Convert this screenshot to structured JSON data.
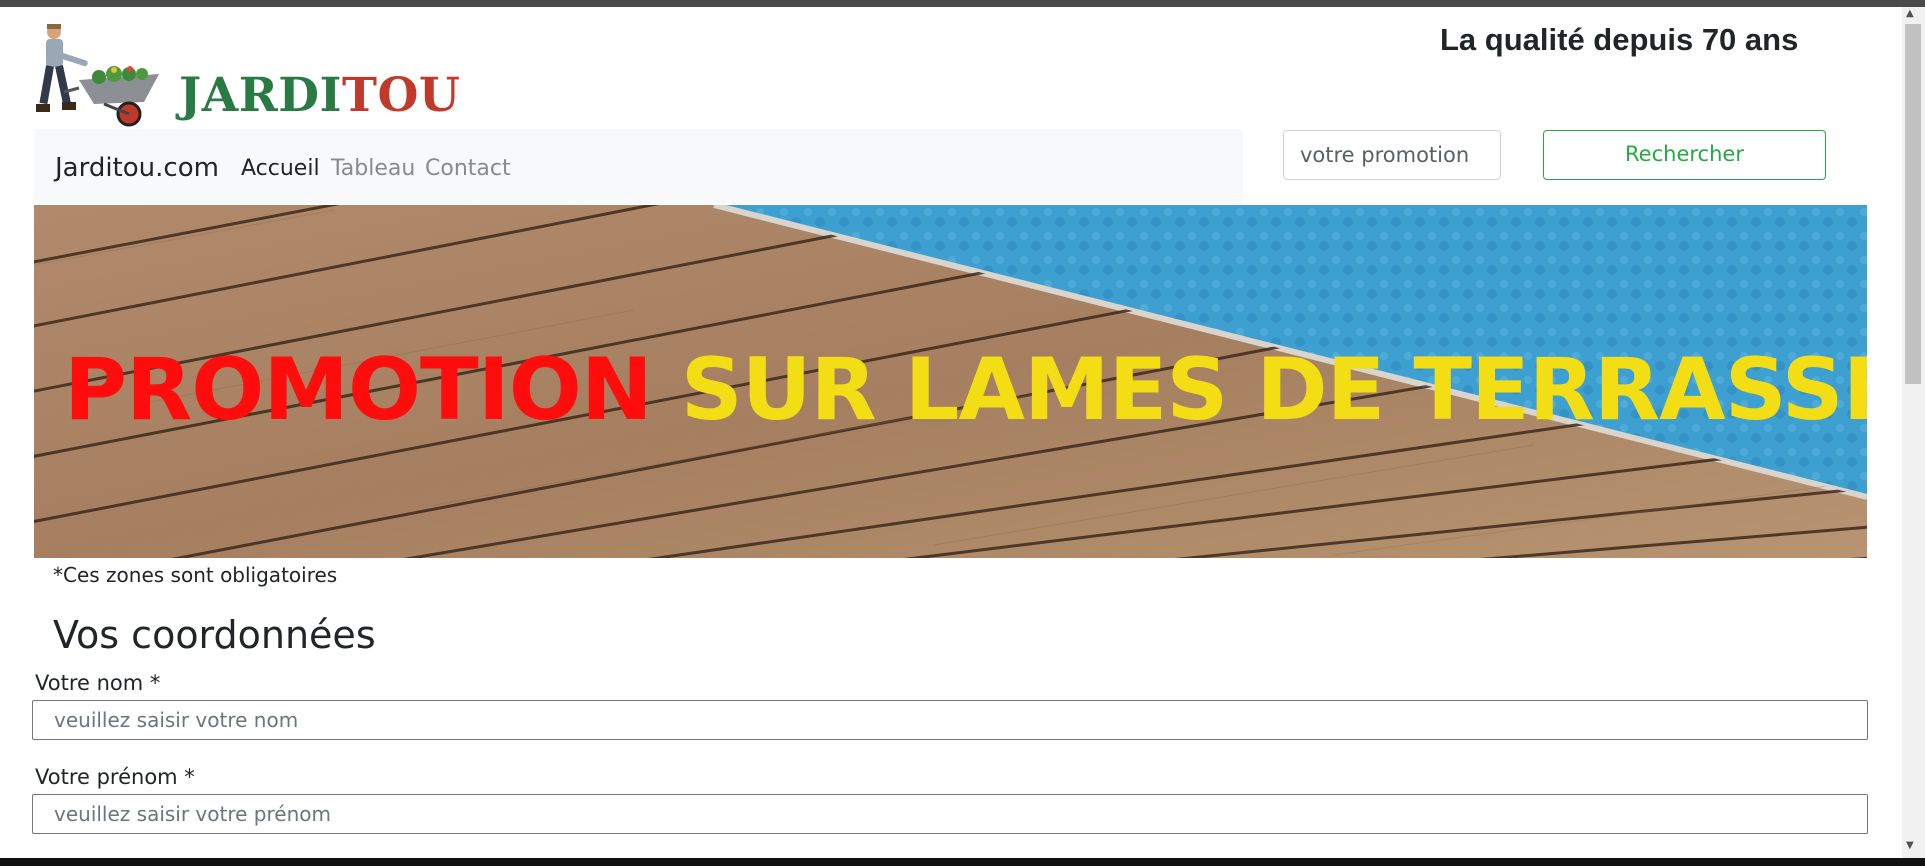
{
  "header": {
    "logo_part1": "JARDI",
    "logo_part2": "TOU",
    "tagline": "La qualité depuis 70 ans"
  },
  "navbar": {
    "brand": "Jarditou.com",
    "links": [
      {
        "label": "Accueil",
        "active": true
      },
      {
        "label": "Tableau",
        "active": false
      },
      {
        "label": "Contact",
        "active": false
      }
    ]
  },
  "search": {
    "placeholder": "votre promotion",
    "button_label": "Rechercher"
  },
  "banner": {
    "text_red": "PROMOTION",
    "text_yellow": "SUR LAMES DE TERRASSE"
  },
  "form": {
    "required_note": "*Ces zones sont obligatoires",
    "section_title": "Vos coordonnées",
    "fields": [
      {
        "label": "Votre nom *",
        "placeholder": "veuillez saisir votre nom"
      },
      {
        "label": "Votre prénom *",
        "placeholder": "veuillez saisir votre prénom"
      }
    ]
  },
  "colors": {
    "brand_green": "#2a7a44",
    "brand_red": "#c0392b",
    "button_green": "#28a745",
    "promo_red": "#ff0d0d",
    "promo_yellow": "#f3dd14"
  }
}
